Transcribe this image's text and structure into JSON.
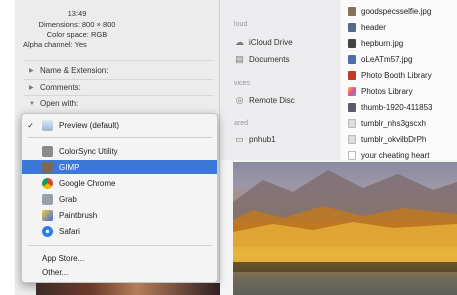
{
  "info_panel": {
    "time": "13:49",
    "dimensions": "Dimensions: 800 × 800",
    "color_space": "Color space: RGB",
    "alpha_channel": "Alpha channel: Yes",
    "sections": [
      "Name & Extension:",
      "Comments:",
      "Open with:"
    ]
  },
  "open_with_menu": {
    "selected": "Preview (default)",
    "apps": [
      "ColorSync Utility",
      "GIMP",
      "Google Chrome",
      "Grab",
      "Paintbrush",
      "Safari"
    ],
    "highlighted": "GIMP",
    "extra": [
      "App Store...",
      "Other..."
    ]
  },
  "finder_sidebar": {
    "sections": [
      "loud",
      "vices",
      "ared"
    ],
    "items": [
      "iCloud Drive",
      "Documents",
      "Remote Disc",
      "pnhub1"
    ]
  },
  "file_list": [
    "goodspecsselfie.jpg",
    "header",
    "hepburn.jpg",
    "oLeATm57.jpg",
    "Photo Booth Library",
    "Photos Library",
    "thumb-1920-411853",
    "tumblr_nhs3gscxh",
    "tumblr_okvilbDrPh",
    "your cheating heart"
  ],
  "colors": {
    "highlight": "#3b78d8"
  }
}
